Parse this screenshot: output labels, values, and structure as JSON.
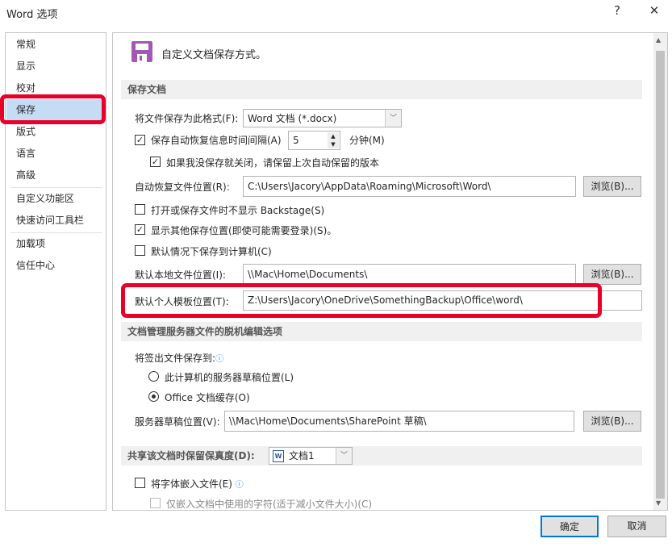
{
  "window": {
    "title": "Word 选项",
    "help": "?",
    "close": "✕"
  },
  "nav": {
    "items": [
      "常规",
      "显示",
      "校对",
      "保存",
      "版式",
      "语言",
      "高级",
      "自定义功能区",
      "快速访问工具栏",
      "加载项",
      "信任中心"
    ],
    "selected": "保存"
  },
  "header": {
    "icon": "save-floppy-icon",
    "text": "自定义文档保存方式。",
    "icon_color": "#a059b4"
  },
  "save_section": {
    "title": "保存文档",
    "format_label": "将文件保存为此格式(F):",
    "format_value": "Word 文档 (*.docx)",
    "autosave_label": "保存自动恢复信息时间间隔(A)",
    "autosave_checked": true,
    "autosave_minutes": "5",
    "minutes_label": "分钟(M)",
    "keep_last_label": "如果我没保存就关闭，请保留上次自动保留的版本",
    "keep_last_checked": true,
    "autorecover_label": "自动恢复文件位置(R):",
    "autorecover_value": "C:\\Users\\Jacory\\AppData\\Roaming\\Microsoft\\Word\\",
    "browse_label": "浏览(B)...",
    "no_backstage_label": "打开或保存文件时不显示 Backstage(S)",
    "no_backstage_checked": false,
    "show_other_label": "显示其他保存位置(即使可能需要登录)(S)。",
    "show_other_checked": true,
    "default_computer_label": "默认情况下保存到计算机(C)",
    "default_computer_checked": false,
    "local_location_label": "默认本地文件位置(I):",
    "local_location_value": "\\\\Mac\\Home\\Documents\\",
    "template_label": "默认个人模板位置(T):",
    "template_value": "Z:\\Users\\Jacory\\OneDrive\\SomethingBackup\\Office\\word\\"
  },
  "offline_section": {
    "title": "文档管理服务器文件的脱机编辑选项",
    "checkout_label": "将签出文件保存到:",
    "radio_server": "此计算机的服务器草稿位置(L)",
    "radio_office": "Office 文档缓存(O)",
    "selected": "Office 文档缓存(O)",
    "drafts_label": "服务器草稿位置(V):",
    "drafts_value": "\\\\Mac\\Home\\Documents\\SharePoint 草稿\\"
  },
  "share_section": {
    "title": "共享该文档时保留保真度(D):",
    "document": "文档1",
    "embed_label": "将字体嵌入文件(E)",
    "embed_checked": false,
    "embed_used_label": "仅嵌入文档中使用的字符(适于减小文件大小)(C)"
  },
  "footer": {
    "ok": "确定",
    "cancel": "取消"
  },
  "highlight_color": "#e8002a"
}
